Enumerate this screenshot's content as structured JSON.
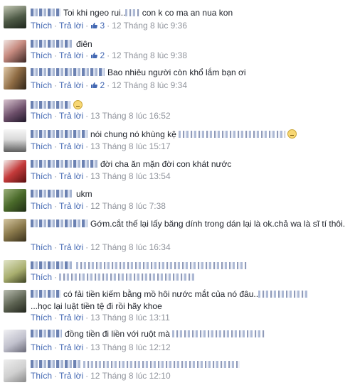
{
  "comments": [
    {
      "text": "Toi khi ngeo rui..",
      "text2": " con k co ma an nua kon",
      "like_label": "Thích",
      "reply_label": "Trả lời",
      "likes": "3",
      "time": "12 Tháng 8 lúc 9:36"
    },
    {
      "text": "điên",
      "like_label": "Thích",
      "reply_label": "Trả lời",
      "likes": "2",
      "time": "12 Tháng 8 lúc 9:38"
    },
    {
      "text": "Bao nhiêu người còn khổ lắm bạn ơi",
      "like_label": "Thích",
      "reply_label": "Trả lời",
      "likes": "2",
      "time": "12 Tháng 8 lúc 9:34"
    },
    {
      "text": "",
      "like_label": "Thích",
      "reply_label": "Trả lời",
      "time": "13 Tháng 8 lúc 16:52"
    },
    {
      "text": "nói chung nó khùng kệ",
      "like_label": "Thích",
      "reply_label": "Trả lời",
      "time": "13 Tháng 8 lúc 15:17"
    },
    {
      "text": "đời cha ăn mặn đời con khát nước",
      "like_label": "Thích",
      "reply_label": "Trả lời",
      "time": "13 Tháng 8 lúc 13:54"
    },
    {
      "text": "ukm",
      "like_label": "Thích",
      "reply_label": "Trả lời",
      "time": "12 Tháng 8 lúc 7:38"
    },
    {
      "text": "Gớm.cắt thế lại lấy băng dính trong dán lại là ok.chả wa là sĩ tí thôi.",
      "like_label": "Thích",
      "reply_label": "Trả lời",
      "time": "12 Tháng 8 lúc 16:34"
    },
    {
      "text": "",
      "like_label": "Thích",
      "reply_label": "Trả lời",
      "time": ""
    },
    {
      "text": "có fải tiền kiếm bằng mồ hôi nước mắt của nó đâu..",
      "text2": "...học lại luật tiền tệ đi rồi hãy khoe",
      "like_label": "Thích",
      "reply_label": "Trả lời",
      "time": "13 Tháng 8 lúc 13:11"
    },
    {
      "text": "đồng tiền đi liền với ruột mà",
      "like_label": "Thích",
      "reply_label": "Trả lời",
      "time": "13 Tháng 8 lúc 12:12"
    },
    {
      "text": "",
      "like_label": "Thích",
      "reply_label": "Trả lời",
      "time": "12 Tháng 8 lúc 12:10"
    }
  ],
  "colors": {
    "link": "#4267b2",
    "meta": "#90949c",
    "text": "#1d2129"
  },
  "icons": {
    "like": "thumbs-up-icon",
    "emoji": "unamused-face-icon"
  }
}
